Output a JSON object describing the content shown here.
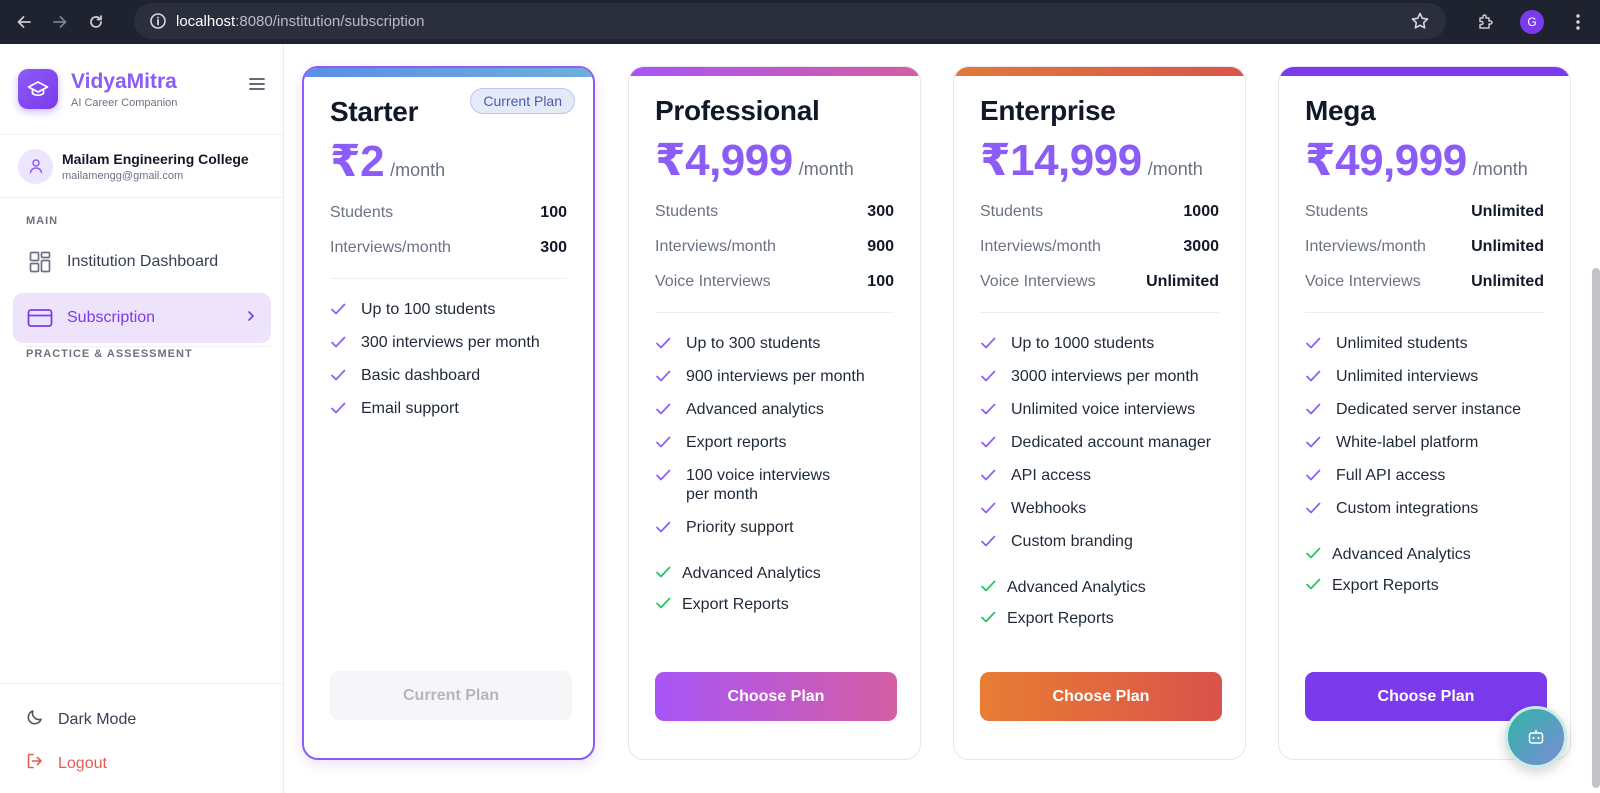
{
  "browser": {
    "url_host": "localhost",
    "url_rest": ":8080/institution/subscription",
    "profile_initial": "G"
  },
  "sidebar": {
    "brand_name": "VidyaMitra",
    "brand_sub": "AI Career Companion",
    "user_name": "Mailam Engineering College",
    "user_email": "mailamengg@gmail.com",
    "section_main": "MAIN",
    "items": [
      {
        "label": "Institution Dashboard",
        "icon": "dashboard-icon",
        "active": false
      },
      {
        "label": "Subscription",
        "icon": "credit-card-icon",
        "active": true
      }
    ],
    "section_practice": "PRACTICE & ASSESSMENT",
    "dark_mode_label": "Dark Mode",
    "logout_label": "Logout"
  },
  "plans": [
    {
      "name": "Starter",
      "price": "₹2",
      "per": "/month",
      "badge": "Current Plan",
      "limits": [
        {
          "k": "Students",
          "v": "100"
        },
        {
          "k": "Interviews/month",
          "v": "300"
        }
      ],
      "features": [
        "Up to 100 students",
        "300 interviews per month",
        "Basic dashboard",
        "Email support"
      ],
      "extras": [],
      "button": "Current Plan",
      "strip": "#5b8ee6",
      "button_color": "#f6f6f8"
    },
    {
      "name": "Professional",
      "price": "₹4,999",
      "per": "/month",
      "limits": [
        {
          "k": "Students",
          "v": "300"
        },
        {
          "k": "Interviews/month",
          "v": "900"
        },
        {
          "k": "Voice Interviews",
          "v": "100"
        }
      ],
      "features": [
        "Up to 300 students",
        "900 interviews per month",
        "Advanced analytics",
        "Export reports",
        "100 voice interviews per month",
        "Priority support"
      ],
      "extras": [
        "Advanced Analytics",
        "Export Reports"
      ],
      "button": "Choose Plan",
      "strip": "#a855f7",
      "button_color": "#b455e0"
    },
    {
      "name": "Enterprise",
      "price": "₹14,999",
      "per": "/month",
      "limits": [
        {
          "k": "Students",
          "v": "1000"
        },
        {
          "k": "Interviews/month",
          "v": "3000"
        },
        {
          "k": "Voice Interviews",
          "v": "Unlimited"
        }
      ],
      "features": [
        "Up to 1000 students",
        "3000 interviews per month",
        "Unlimited voice interviews",
        "Dedicated account manager",
        "API access",
        "Webhooks",
        "Custom branding"
      ],
      "extras": [
        "Advanced Analytics",
        "Export Reports"
      ],
      "button": "Choose Plan",
      "strip": "#e07a3a",
      "button_color": "#e26a3e"
    },
    {
      "name": "Mega",
      "price": "₹49,999",
      "per": "/month",
      "limits": [
        {
          "k": "Students",
          "v": "Unlimited"
        },
        {
          "k": "Interviews/month",
          "v": "Unlimited"
        },
        {
          "k": "Voice Interviews",
          "v": "Unlimited"
        }
      ],
      "features": [
        "Unlimited students",
        "Unlimited interviews",
        "Dedicated server instance",
        "White-label platform",
        "Full API access",
        "Custom integrations"
      ],
      "extras": [
        "Advanced Analytics",
        "Export Reports"
      ],
      "button": "Choose Plan",
      "strip": "#7c3aed",
      "button_color": "#7c3aed"
    }
  ]
}
